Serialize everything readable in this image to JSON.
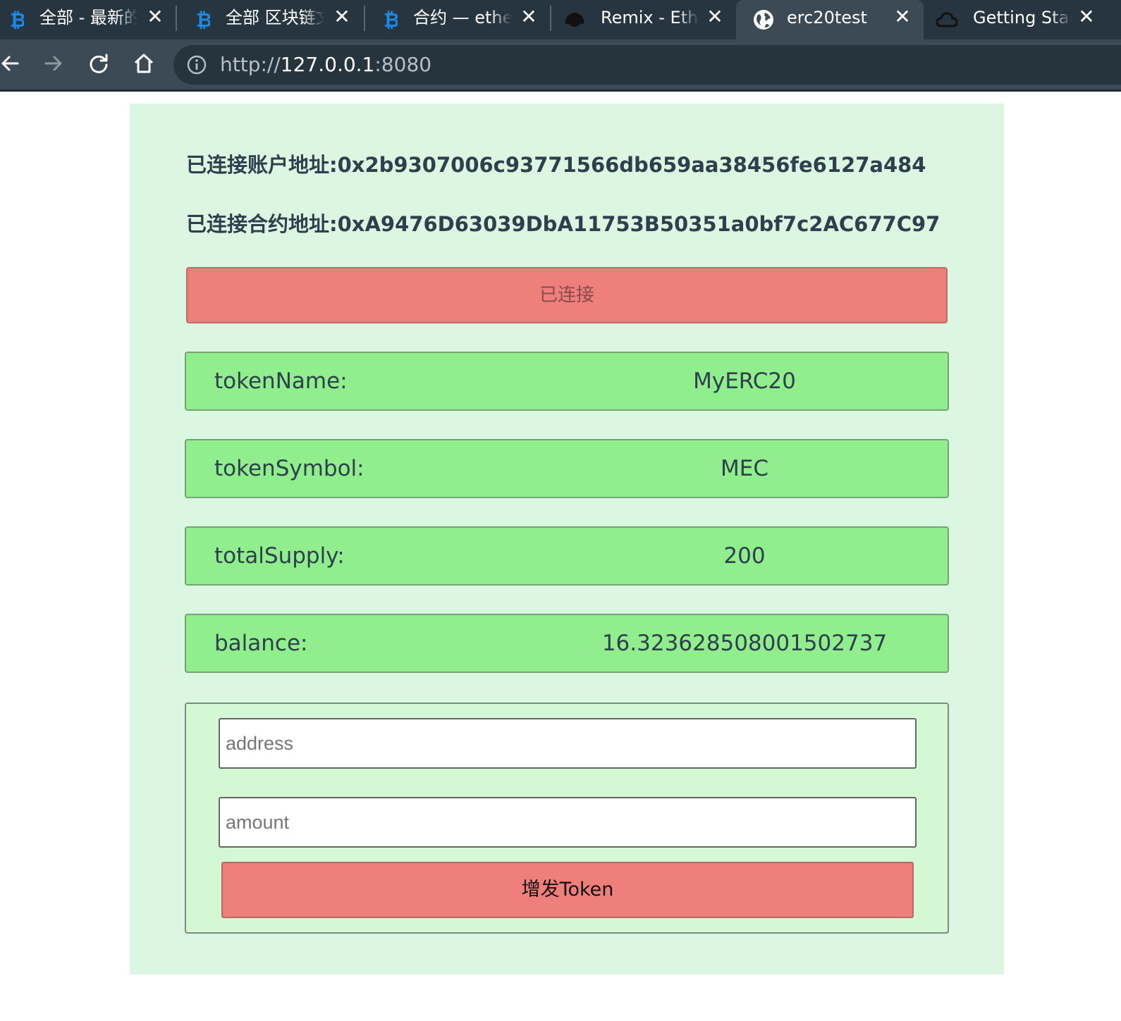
{
  "browser": {
    "tabs": [
      {
        "title": "全部 - 最新的",
        "icon": "bitcoin-icon",
        "active": false
      },
      {
        "title": "全部 区块链文",
        "icon": "bitcoin-icon",
        "active": false
      },
      {
        "title": "合约 — ethe",
        "icon": "bitcoin-icon",
        "active": false
      },
      {
        "title": "Remix - Ethe",
        "icon": "remix-icon",
        "active": false
      },
      {
        "title": "erc20test",
        "icon": "globe-icon",
        "active": true
      },
      {
        "title": "Getting Star",
        "icon": "cloud-icon",
        "active": false
      }
    ],
    "close_glyph": "✕",
    "url_scheme": "http://",
    "url_host": "127.0.0.1",
    "url_port": ":8080"
  },
  "page": {
    "account_label": "已连接账户地址:",
    "account_address": "0x2b9307006c93771566db659aa38456fe6127a484",
    "contract_label": "已连接合约地址:",
    "contract_address": "0xA9476D63039DbA11753B50351a0bf7c2AC677C97",
    "connect_button": "已连接",
    "fields": [
      {
        "label": "tokenName:",
        "value": "MyERC20"
      },
      {
        "label": "tokenSymbol:",
        "value": "MEC"
      },
      {
        "label": "totalSupply:",
        "value": "200"
      },
      {
        "label": "balance:",
        "value": "16.323628508001502737"
      }
    ],
    "form": {
      "address_placeholder": "address",
      "amount_placeholder": "amount",
      "mint_button": "增发Token"
    }
  },
  "colors": {
    "tabbar": "#263540",
    "toolbar": "#3b4a55",
    "panel": "#dbf7e1",
    "field": "#91ee8c",
    "button": "#ef7f7b"
  }
}
